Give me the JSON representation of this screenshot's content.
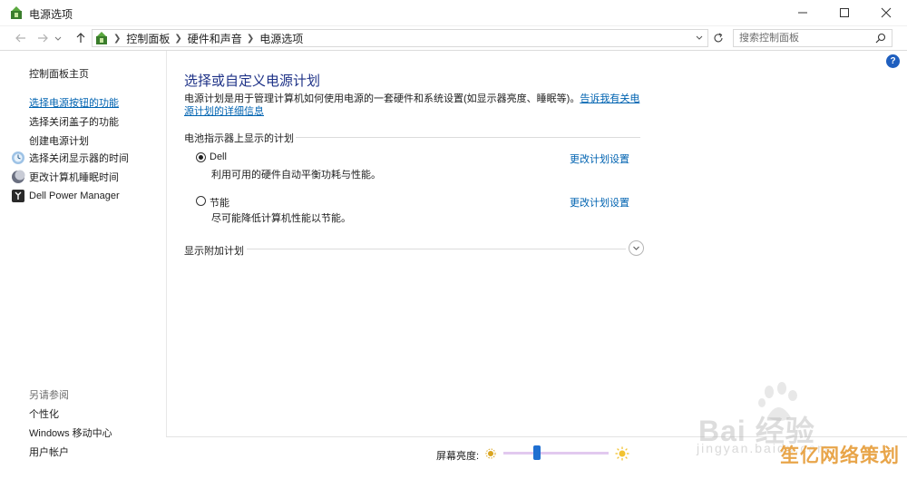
{
  "window": {
    "title": "电源选项"
  },
  "address": {
    "breadcrumbs": [
      "控制面板",
      "硬件和声音",
      "电源选项"
    ],
    "search_placeholder": "搜索控制面板"
  },
  "sidebar": {
    "home": "控制面板主页",
    "links": [
      "选择电源按钮的功能",
      "选择关闭盖子的功能",
      "创建电源计划"
    ],
    "icon_links": [
      {
        "label": "选择关闭显示器的时间",
        "icon": "monitor-icon"
      },
      {
        "label": "更改计算机睡眠时间",
        "icon": "moon-icon"
      },
      {
        "label": "Dell Power Manager",
        "icon": "dell-power-icon"
      }
    ],
    "see_also_title": "另请参阅",
    "see_also": [
      "个性化",
      "Windows 移动中心",
      "用户帐户"
    ]
  },
  "main": {
    "title": "选择或自定义电源计划",
    "description": "电源计划是用于管理计算机如何使用电源的一套硬件和系统设置(如显示器亮度、睡眠等)。",
    "description_link": "告诉我有关电源计划的详细信息",
    "battery_section": "电池指示器上显示的计划",
    "plans": [
      {
        "name": "Dell",
        "desc": "利用可用的硬件自动平衡功耗与性能。",
        "selected": true,
        "change": "更改计划设置"
      },
      {
        "name": "节能",
        "desc": "尽可能降低计算机性能以节能。",
        "selected": false,
        "change": "更改计划设置"
      }
    ],
    "additional_section": "显示附加计划",
    "help": "?"
  },
  "bottom": {
    "brightness_label": "屏幕亮度:",
    "brightness_level": 0.31
  },
  "watermark": {
    "brand": "Bai 经验",
    "url": "jingyan.baidu.com",
    "badge": "笙亿网络策划"
  }
}
